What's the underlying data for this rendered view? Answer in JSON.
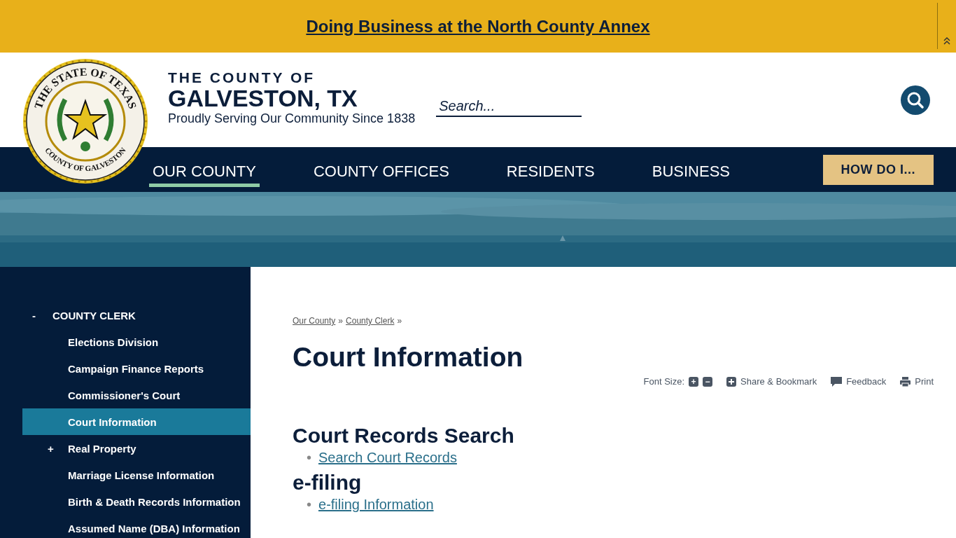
{
  "alert_banner": {
    "link": "Doing Business at the North County Annex"
  },
  "seal": {
    "top_text": "THE STATE OF TEXAS",
    "bottom_text": "COUNTY OF GALVESTON"
  },
  "site_title": {
    "line_1": "THE COUNTY OF",
    "line_2": "GALVESTON, TX",
    "tagline": "Proudly Serving Our Community Since 1838"
  },
  "search": {
    "placeholder": "Search..."
  },
  "nav": [
    {
      "label": "OUR COUNTY",
      "selected": true,
      "kind": "link"
    },
    {
      "label": "COUNTY OFFICES",
      "selected": false,
      "kind": "link"
    },
    {
      "label": "RESIDENTS",
      "selected": false,
      "kind": "link"
    },
    {
      "label": "BUSINESS",
      "selected": false,
      "kind": "link"
    },
    {
      "label": "HOW DO I...",
      "selected": false,
      "kind": "button"
    }
  ],
  "sidebar": {
    "items": [
      {
        "label": "COUNTY CLERK",
        "toggle": "-",
        "selected": false,
        "children": [
          {
            "label": "Elections Division",
            "selected": false
          },
          {
            "label": "Campaign Finance Reports",
            "selected": false
          },
          {
            "label": "Commissioner's Court",
            "selected": false
          },
          {
            "label": "Court Information",
            "selected": true
          },
          {
            "label": "Real Property",
            "toggle": "+",
            "selected": false
          },
          {
            "label": "Marriage License Information",
            "selected": false
          },
          {
            "label": "Birth & Death Records Information",
            "selected": false
          },
          {
            "label": "Assumed Name (DBA) Information",
            "selected": false
          }
        ]
      }
    ]
  },
  "breadcrumbs": [
    "Our County",
    "County Clerk"
  ],
  "breadcrumb_separator": "»",
  "page_title": "Court Information",
  "tools": {
    "font_size_label": "Font Size:",
    "font_buttons": [
      "+",
      "−"
    ],
    "share": "Share & Bookmark",
    "feedback": "Feedback",
    "print": "Print"
  },
  "sections": [
    {
      "heading": "Court Records Search",
      "bullet": "•",
      "links": [
        "Search Court Records"
      ]
    },
    {
      "heading": "e-filing",
      "bullet": "•",
      "links": [
        "e-filing Information"
      ]
    }
  ]
}
